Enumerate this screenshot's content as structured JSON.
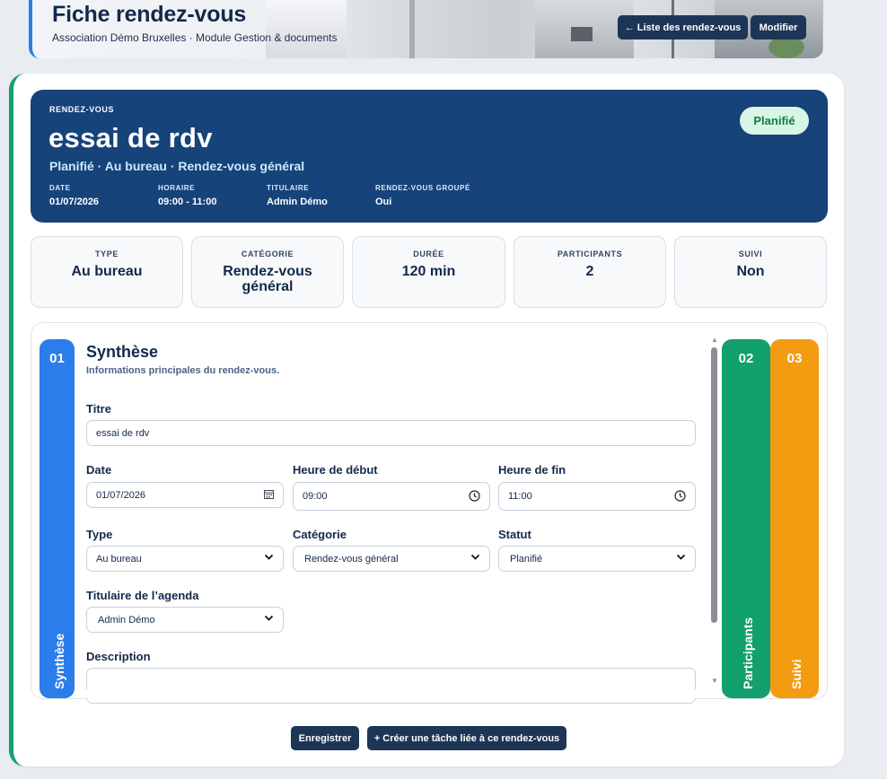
{
  "header": {
    "title": "Fiche rendez-vous",
    "subtitle": "Association Démo Bruxelles · Module Gestion & documents",
    "list_button": "← Liste des rendez-vous",
    "edit_button": "Modifier"
  },
  "hero": {
    "overline": "RENDEZ-VOUS",
    "name": "essai de rdv",
    "meta": "Planifié · Au bureau · Rendez-vous général",
    "status_pill": "Planifié",
    "fields": [
      {
        "key": "DATE",
        "value": "01/07/2026"
      },
      {
        "key": "HORAIRE",
        "value": "09:00 - 11:00"
      },
      {
        "key": "TITULAIRE",
        "value": "Admin Démo"
      },
      {
        "key": "RENDEZ-VOUS GROUPÉ",
        "value": "Oui"
      }
    ]
  },
  "stats": [
    {
      "key": "TYPE",
      "value": "Au bureau"
    },
    {
      "key": "CATÉGORIE",
      "value": "Rendez-vous général"
    },
    {
      "key": "DURÉE",
      "value": "120 min"
    },
    {
      "key": "PARTICIPANTS",
      "value": "2"
    },
    {
      "key": "SUIVI",
      "value": "Non"
    }
  ],
  "tabs": [
    {
      "num": "01",
      "label": "Synthèse",
      "color": "#2b7de9"
    },
    {
      "num": "02",
      "label": "Participants",
      "color": "#12a06c"
    },
    {
      "num": "03",
      "label": "Suivi",
      "color": "#f39c12"
    }
  ],
  "section": {
    "title": "Synthèse",
    "subtitle": "Informations principales du rendez-vous."
  },
  "form": {
    "titre_label": "Titre",
    "titre_value": "essai de rdv",
    "date_label": "Date",
    "date_value": "01/07/2026",
    "start_label": "Heure de début",
    "start_value": "09:00",
    "end_label": "Heure de fin",
    "end_value": "11:00",
    "type_label": "Type",
    "type_value": "Au bureau",
    "categorie_label": "Catégorie",
    "categorie_value": "Rendez-vous général",
    "statut_label": "Statut",
    "statut_value": "Planifié",
    "titulaire_label": "Titulaire de l’agenda",
    "titulaire_value": "Admin Démo",
    "description_label": "Description"
  },
  "actions": {
    "save": "Enregistrer",
    "create_task": "+ Créer une tâche liée à ce rendez-vous"
  },
  "icons": {
    "calendar": "calendar-icon",
    "clock": "clock-icon",
    "chevron": "chevron-down-icon"
  }
}
